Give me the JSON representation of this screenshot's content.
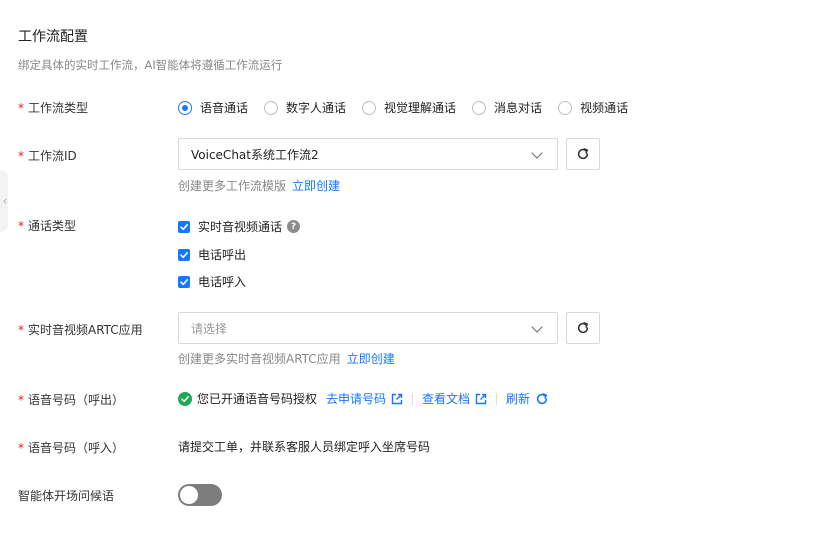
{
  "header": {
    "title": "工作流配置",
    "subtitle": "绑定具体的实时工作流，AI智能体将遵循工作流运行"
  },
  "required_mark": "*",
  "workflow_type": {
    "label": "工作流类型",
    "options": [
      "语音通话",
      "数字人通话",
      "视觉理解通话",
      "消息对话",
      "视频通话"
    ],
    "selected": "语音通话"
  },
  "workflow_id": {
    "label": "工作流ID",
    "value": "VoiceChat系统工作流2",
    "helper": "创建更多工作流模版",
    "helper_link": "立即创建"
  },
  "call_type": {
    "label": "通话类型",
    "options": [
      {
        "label": "实时音视频通话",
        "checked": true,
        "help": "?"
      },
      {
        "label": "电话呼出",
        "checked": true
      },
      {
        "label": "电话呼入",
        "checked": true
      }
    ]
  },
  "artc_app": {
    "label": "实时音视频ARTC应用",
    "placeholder": "请选择",
    "helper": "创建更多实时音视频ARTC应用",
    "helper_link": "立即创建"
  },
  "outbound_number": {
    "label": "语音号码（呼出）",
    "status": "您已开通语音号码授权",
    "links": [
      "去申请号码",
      "查看文档",
      "刷新"
    ]
  },
  "inbound_number": {
    "label": "语音号码（呼入）",
    "text": "请提交工单，并联系客服人员绑定呼入坐席号码"
  },
  "greeting": {
    "label": "智能体开场问候语",
    "enabled": false
  },
  "colors": {
    "primary": "#1677ff",
    "success": "#1fa855",
    "required": "#e02020"
  }
}
